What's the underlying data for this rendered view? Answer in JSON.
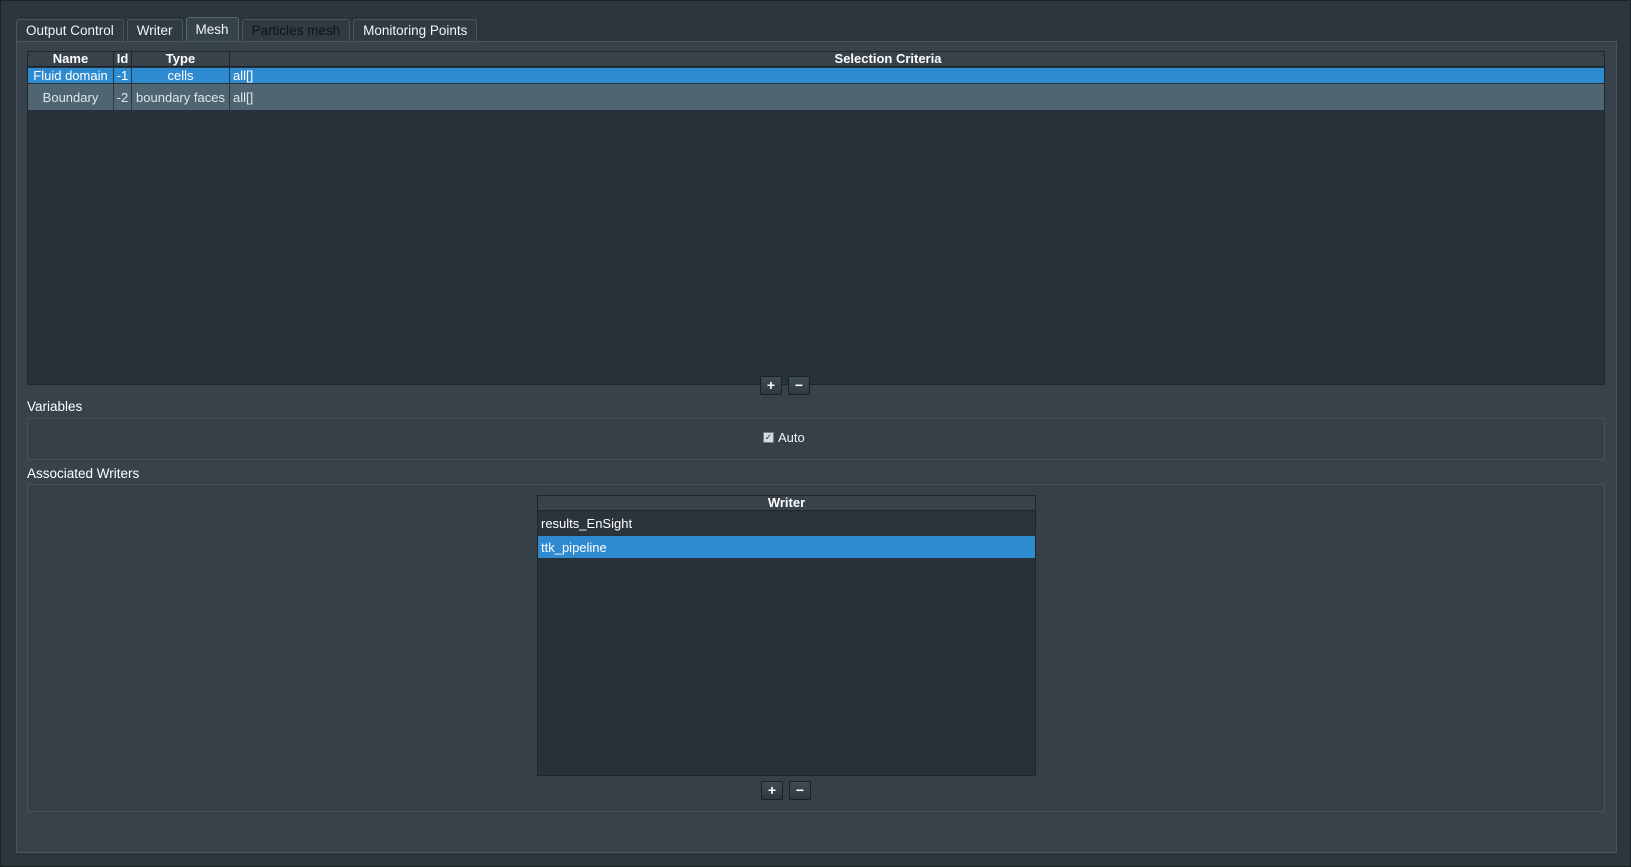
{
  "tabs": [
    {
      "label": "Output Control",
      "state": "normal"
    },
    {
      "label": "Writer",
      "state": "normal"
    },
    {
      "label": "Mesh",
      "state": "active"
    },
    {
      "label": "Particles mesh",
      "state": "disabled"
    },
    {
      "label": "Monitoring Points",
      "state": "normal"
    }
  ],
  "mesh_table": {
    "columns": [
      "Name",
      "Id",
      "Type",
      "Selection Criteria"
    ],
    "rows": [
      {
        "name": "Fluid domain",
        "id": "-1",
        "type": "cells",
        "criteria": "all[]",
        "selected": true
      },
      {
        "name": "Boundary",
        "id": "-2",
        "type": "boundary faces",
        "criteria": "all[]",
        "selected": false
      }
    ]
  },
  "buttons": {
    "add": "+",
    "remove": "−"
  },
  "variables": {
    "label": "Variables",
    "auto_label": "Auto",
    "auto_checked": true,
    "check_glyph": "✓"
  },
  "writers": {
    "label": "Associated Writers",
    "column": "Writer",
    "items": [
      {
        "label": "results_EnSight",
        "selected": false
      },
      {
        "label": "ttk_pipeline",
        "selected": true
      }
    ]
  },
  "colors": {
    "selection": "#2f8bd0",
    "background": "#2b353c",
    "panel": "#37424a"
  }
}
